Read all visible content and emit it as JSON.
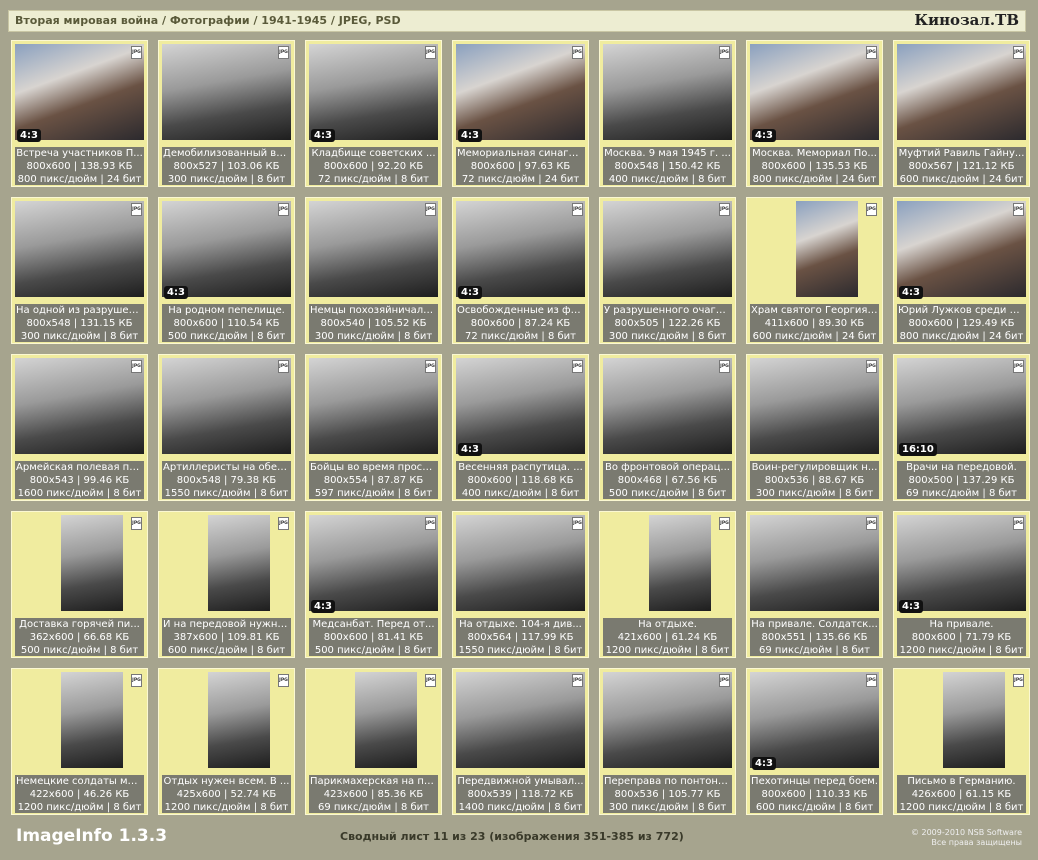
{
  "header": {
    "breadcrumb": "Вторая мировая война / Фотографии / 1941-1945 / JPEG, PSD",
    "brand": "Кинозал.ТВ"
  },
  "footer": {
    "app_name": "ImageInfo 1.3.3",
    "sheet_info": "Сводный лист 11 из 23 (изображения 351-385 из 772)",
    "copyright_line1": "© 2009-2010 NSB Software",
    "copyright_line2": "Все права защищены"
  },
  "file_badge": "JPG",
  "items": [
    {
      "title": "Встреча участников П...",
      "dims": "800x600 | 138.93 КБ",
      "meta": "800 пикс/дюйм | 24 бит",
      "ratio": "4:3",
      "shape": "land",
      "tone": "color"
    },
    {
      "title": "Демобилизованный во...",
      "dims": "800x527 | 103.06 КБ",
      "meta": "300 пикс/дюйм | 8 бит",
      "ratio": "",
      "shape": "land",
      "tone": "bw"
    },
    {
      "title": "Кладбище советских ...",
      "dims": "800x600 | 92.20 КБ",
      "meta": "72 пикс/дюйм | 8 бит",
      "ratio": "4:3",
      "shape": "land",
      "tone": "bw"
    },
    {
      "title": "Мемориальная синаго...",
      "dims": "800x600 | 97.63 КБ",
      "meta": "72 пикс/дюйм | 24 бит",
      "ratio": "4:3",
      "shape": "land",
      "tone": "color"
    },
    {
      "title": "Москва. 9 мая 1945 г. ...",
      "dims": "800x548 | 150.42 КБ",
      "meta": "400 пикс/дюйм | 8 бит",
      "ratio": "",
      "shape": "land",
      "tone": "bw"
    },
    {
      "title": "Москва. Мемориал По...",
      "dims": "800x600 | 135.53 КБ",
      "meta": "800 пикс/дюйм | 24 бит",
      "ratio": "4:3",
      "shape": "land",
      "tone": "color"
    },
    {
      "title": "Муфтий Равиль Гайну...",
      "dims": "800x567 | 121.12 КБ",
      "meta": "600 пикс/дюйм | 24 бит",
      "ratio": "",
      "shape": "land",
      "tone": "color"
    },
    {
      "title": "На одной из разрушен...",
      "dims": "800x548 | 131.15 КБ",
      "meta": "300 пикс/дюйм | 8 бит",
      "ratio": "",
      "shape": "land",
      "tone": "bw"
    },
    {
      "title": "На родном пепелище.",
      "dims": "800x600 | 110.54 КБ",
      "meta": "500 пикс/дюйм | 8 бит",
      "ratio": "4:3",
      "shape": "land",
      "tone": "bw"
    },
    {
      "title": "Немцы похозяйничали...",
      "dims": "800x540 | 105.52 КБ",
      "meta": "300 пикс/дюйм | 8 бит",
      "ratio": "",
      "shape": "land",
      "tone": "bw"
    },
    {
      "title": "Освобожденные из фа...",
      "dims": "800x600 | 87.24 КБ",
      "meta": "72 пикс/дюйм | 8 бит",
      "ratio": "4:3",
      "shape": "land",
      "tone": "bw"
    },
    {
      "title": "У разрушенного очага...",
      "dims": "800x505 | 122.26 КБ",
      "meta": "300 пикс/дюйм | 8 бит",
      "ratio": "",
      "shape": "land",
      "tone": "bw"
    },
    {
      "title": "Храм святого Георгия ...",
      "dims": "411x600 | 89.30 КБ",
      "meta": "600 пикс/дюйм | 24 бит",
      "ratio": "",
      "shape": "port",
      "tone": "color"
    },
    {
      "title": "Юрий Лужков среди в...",
      "dims": "800x600 | 129.49 КБ",
      "meta": "800 пикс/дюйм | 24 бит",
      "ratio": "4:3",
      "shape": "land",
      "tone": "color"
    },
    {
      "title": "Армейская полевая пе...",
      "dims": "800x543 | 99.46 КБ",
      "meta": "1600 пикс/дюйм | 8 бит",
      "ratio": "",
      "shape": "land",
      "tone": "bw"
    },
    {
      "title": "Артиллеристы на обеде.",
      "dims": "800x548 | 79.38 КБ",
      "meta": "1550 пикс/дюйм | 8 бит",
      "ratio": "",
      "shape": "land",
      "tone": "bw"
    },
    {
      "title": "Бойцы во время просм...",
      "dims": "800x554 | 87.87 КБ",
      "meta": "597 пикс/дюйм | 8 бит",
      "ratio": "",
      "shape": "land",
      "tone": "bw"
    },
    {
      "title": "Весенняя распутица. ...",
      "dims": "800x600 | 118.68 КБ",
      "meta": "400 пикс/дюйм | 8 бит",
      "ratio": "4:3",
      "shape": "land",
      "tone": "bw"
    },
    {
      "title": "Во фронтовой операц...",
      "dims": "800x468 | 67.56 КБ",
      "meta": "500 пикс/дюйм | 8 бит",
      "ratio": "",
      "shape": "land",
      "tone": "bw"
    },
    {
      "title": "Воин-регулировщик н...",
      "dims": "800x536 | 88.67 КБ",
      "meta": "300 пикс/дюйм | 8 бит",
      "ratio": "",
      "shape": "land",
      "tone": "bw"
    },
    {
      "title": "Врачи на передовой.",
      "dims": "800x500 | 137.29 КБ",
      "meta": "69 пикс/дюйм | 8 бит",
      "ratio": "16:10",
      "shape": "land",
      "tone": "bw"
    },
    {
      "title": "Доставка горячей пи...",
      "dims": "362x600 | 66.68 КБ",
      "meta": "500 пикс/дюйм | 8 бит",
      "ratio": "",
      "shape": "port",
      "tone": "bw"
    },
    {
      "title": "И на передовой нужно...",
      "dims": "387x600 | 109.81 КБ",
      "meta": "600 пикс/дюйм | 8 бит",
      "ratio": "",
      "shape": "port",
      "tone": "bw"
    },
    {
      "title": "Медсанбат. Перед от...",
      "dims": "800x600 | 81.41 КБ",
      "meta": "500 пикс/дюйм | 8 бит",
      "ratio": "4:3",
      "shape": "land",
      "tone": "bw"
    },
    {
      "title": "На отдыхе. 104-я див...",
      "dims": "800x564 | 117.99 КБ",
      "meta": "1550 пикс/дюйм | 8 бит",
      "ratio": "",
      "shape": "land",
      "tone": "bw"
    },
    {
      "title": "На отдыхе.",
      "dims": "421x600 | 61.24 КБ",
      "meta": "1200 пикс/дюйм | 8 бит",
      "ratio": "",
      "shape": "port",
      "tone": "bw"
    },
    {
      "title": "На привале. Солдатск...",
      "dims": "800x551 | 135.66 КБ",
      "meta": "69 пикс/дюйм | 8 бит",
      "ratio": "",
      "shape": "land",
      "tone": "bw"
    },
    {
      "title": "На привале.",
      "dims": "800x600 | 71.79 КБ",
      "meta": "1200 пикс/дюйм | 8 бит",
      "ratio": "4:3",
      "shape": "land",
      "tone": "bw"
    },
    {
      "title": "Немецкие солдаты мо...",
      "dims": "422x600 | 46.26 КБ",
      "meta": "1200 пикс/дюйм | 8 бит",
      "ratio": "",
      "shape": "port",
      "tone": "bw"
    },
    {
      "title": "Отдых нужен всем. В ...",
      "dims": "425x600 | 52.74 КБ",
      "meta": "1200 пикс/дюйм | 8 бит",
      "ratio": "",
      "shape": "port",
      "tone": "bw"
    },
    {
      "title": "Парикмахерская на пе...",
      "dims": "423x600 | 85.36 КБ",
      "meta": "69 пикс/дюйм | 8 бит",
      "ratio": "",
      "shape": "port",
      "tone": "bw"
    },
    {
      "title": "Передвижной умывал...",
      "dims": "800x539 | 118.72 КБ",
      "meta": "1400 пикс/дюйм | 8 бит",
      "ratio": "",
      "shape": "land",
      "tone": "bw"
    },
    {
      "title": "Переправа по понтонн...",
      "dims": "800x536 | 105.77 КБ",
      "meta": "300 пикс/дюйм | 8 бит",
      "ratio": "",
      "shape": "land",
      "tone": "bw"
    },
    {
      "title": "Пехотинцы перед боем.",
      "dims": "800x600 | 110.33 КБ",
      "meta": "600 пикс/дюйм | 8 бит",
      "ratio": "4:3",
      "shape": "land",
      "tone": "bw"
    },
    {
      "title": "Письмо в Германию.",
      "dims": "426x600 | 61.15 КБ",
      "meta": "1200 пикс/дюйм | 8 бит",
      "ratio": "",
      "shape": "port",
      "tone": "bw"
    }
  ]
}
